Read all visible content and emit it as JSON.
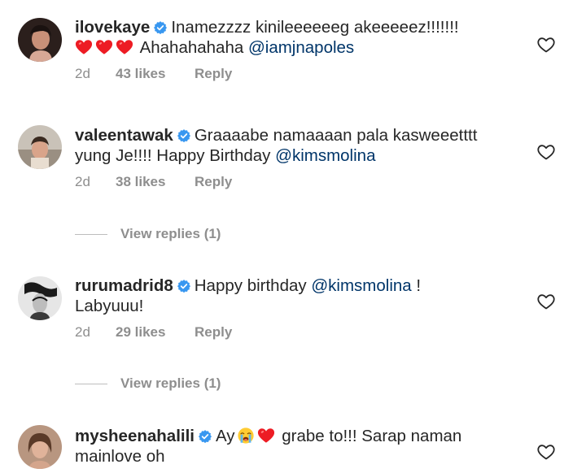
{
  "comments": [
    {
      "username": "ilovekaye",
      "text_before": "Inamezzzz kinileeeeeeg akeeeeez!!!!!!!",
      "text_line2": "Ahahahahaha",
      "mention": "@iamjnapoles",
      "age": "2d",
      "likes": "43 likes",
      "reply": "Reply"
    },
    {
      "username": "valeentawak",
      "text_before": "Graaaabe namaaaan pala kasweeetttt yung Je!!!! Happy Birthday",
      "mention": "@kimsmolina",
      "age": "2d",
      "likes": "38 likes",
      "reply": "Reply",
      "view_replies": "View replies (1)"
    },
    {
      "username": "rurumadrid8",
      "text_before": "Happy birthday",
      "mention": "@kimsmolina",
      "text_after": " !",
      "text_line2": "Labyuuu!",
      "age": "2d",
      "likes": "29 likes",
      "reply": "Reply",
      "view_replies": "View replies (1)"
    },
    {
      "username": "mysheenahalili",
      "text_before": "Ay",
      "text_after": "grabe to!!! Sarap naman mainlove oh"
    }
  ],
  "colors": {
    "verified": "#3897f0",
    "heart_red": "#ed1c24",
    "mention": "#003569",
    "meta": "#8e8e8e"
  },
  "icons": {
    "verified": "verified-badge-icon",
    "like": "heart-outline-icon",
    "heart_emoji": "red-heart-emoji-icon",
    "crying_emoji": "loudly-crying-face-emoji-icon"
  }
}
